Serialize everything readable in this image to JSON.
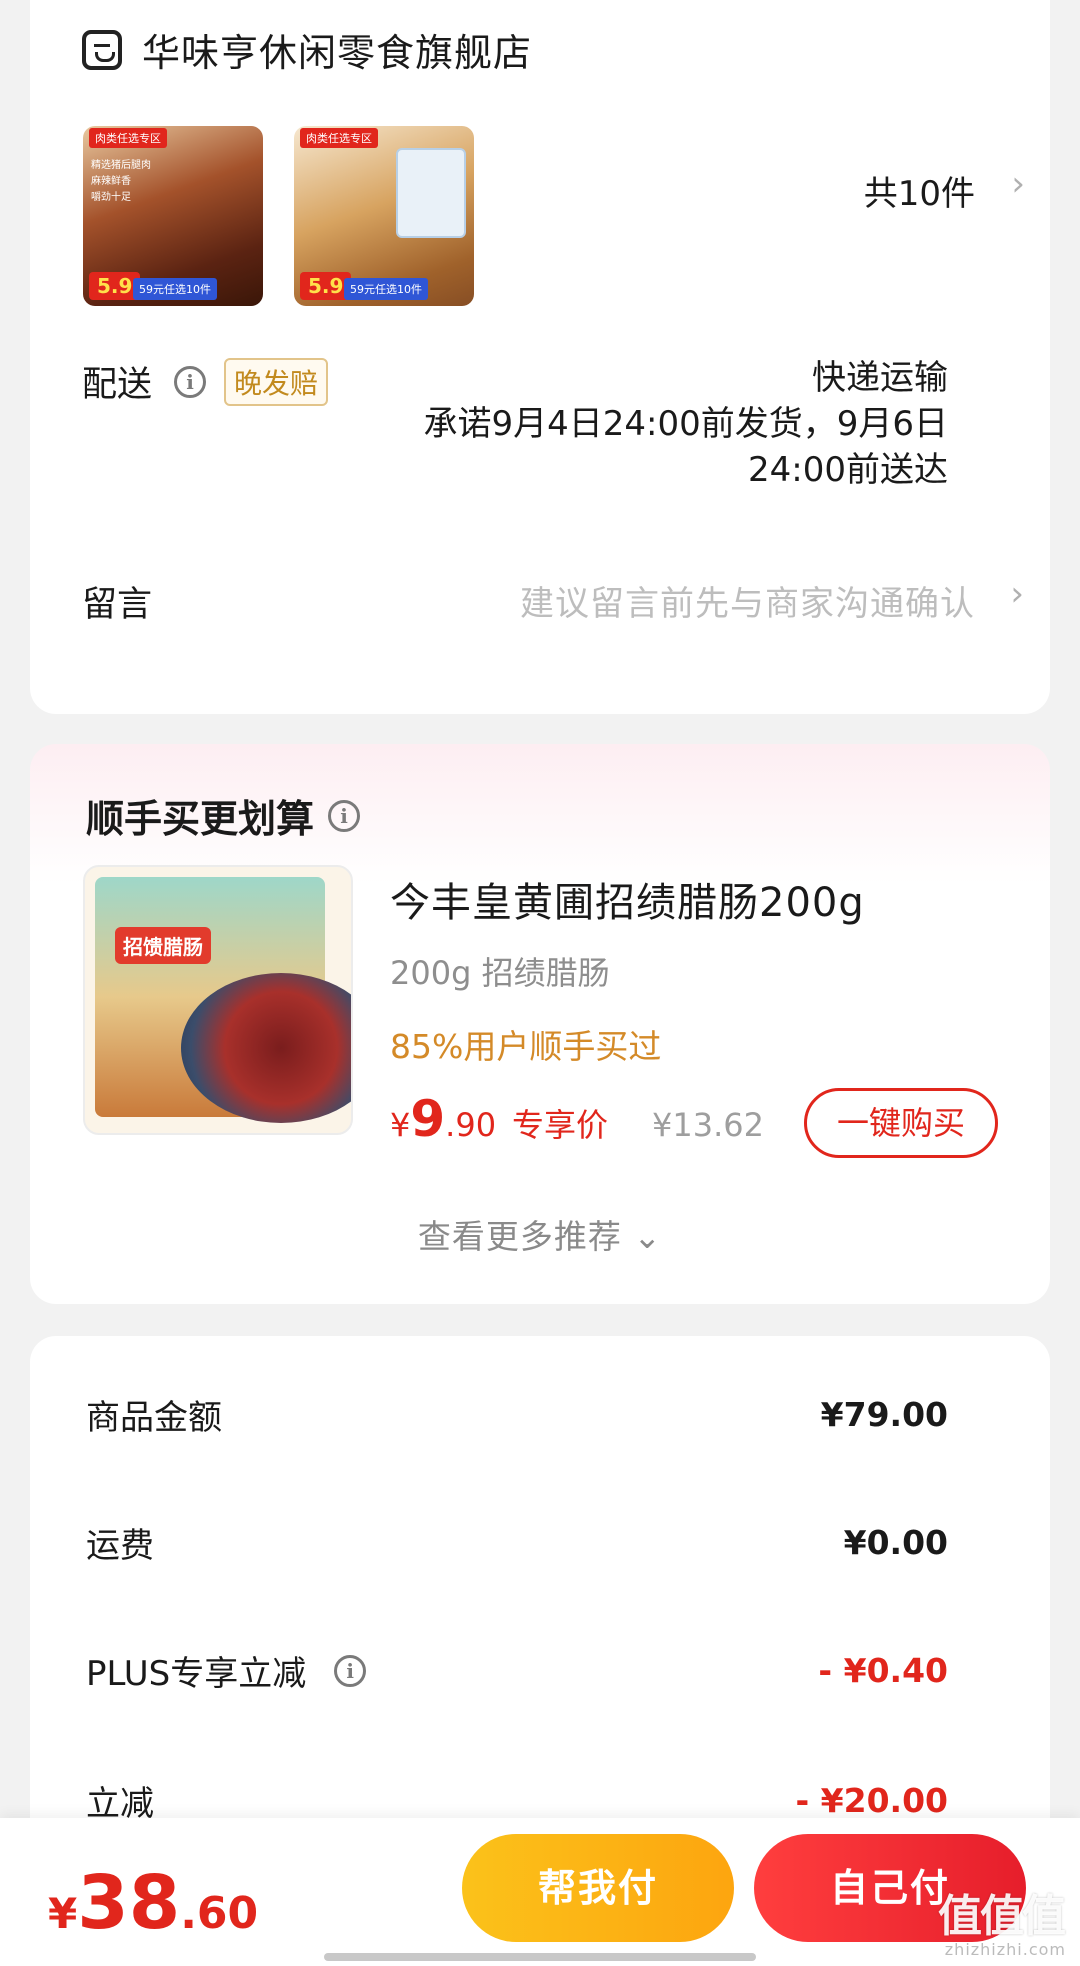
{
  "store": {
    "icon": "store-icon",
    "name": "华味亨休闲零食旗舰店",
    "thumbnails": [
      {
        "tag": "肉类任选专区",
        "price_badge": "5.9",
        "promo": "59元任选10件",
        "features": [
          "精选猪后腿肉",
          "麻辣鲜香",
          "嚼劲十足"
        ]
      },
      {
        "tag": "肉类任选专区",
        "price_badge": "5.9",
        "promo": "59元任选10件"
      }
    ],
    "item_count": "共10件"
  },
  "delivery": {
    "label": "配送",
    "badge": "晚发赔",
    "method": "快递运输",
    "promise": "承诺9月4日24:00前发货，9月6日24:00前送达"
  },
  "message": {
    "label": "留言",
    "placeholder": "建议留言前先与商家沟通确认"
  },
  "recommend": {
    "title": "顺手买更划算",
    "image_label": "招馈腊肠",
    "product_name": "今丰皇黄圃招绩腊肠200g",
    "spec": "200g 招绩腊肠",
    "hot_text": "85%用户顺手买过",
    "price_yen": "¥",
    "price_int": "9",
    "price_dec": ".90",
    "price_label": "专享价",
    "original_price": "¥13.62",
    "buy_label": "一键购买",
    "more_label": "查看更多推荐"
  },
  "amounts": {
    "rows": [
      {
        "label": "商品金额",
        "value": "¥79.00"
      },
      {
        "label": "运费",
        "value": "¥0.00"
      },
      {
        "label": "PLUS专享立减",
        "value": "- ¥0.40"
      },
      {
        "label": "立减",
        "value": "- ¥20.00"
      }
    ]
  },
  "bottom": {
    "total_yen": "¥",
    "total_int": "38",
    "total_dec": ".60",
    "help_pay_label": "帮我付",
    "self_pay_label": "自己付"
  },
  "watermark": {
    "main": "值值值",
    "sub": "zhizhizhi.com"
  },
  "colors": {
    "accent_red": "#e1261c",
    "help_pay_yellow": "#fbc21a",
    "hot_orange": "#d48a28"
  }
}
